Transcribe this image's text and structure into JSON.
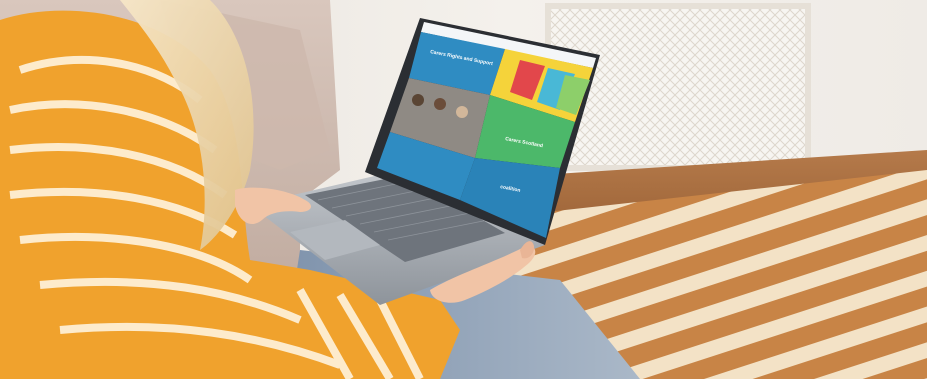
{
  "scene": {
    "site": {
      "hero_heading": "Carers Rights and Support",
      "feature_heading": "Carers Scotland",
      "footer_logo_text": "coalition"
    },
    "colors": {
      "wall": "#f2efeb",
      "floor": "#8a4c22",
      "rug_stripe": "#f3e2c6",
      "sweater": "#f0a22d",
      "sweater_stripe": "#fff3de",
      "laptop": "#a8adb4",
      "site_blue": "#2f8cc2",
      "site_green": "#4cb86a"
    }
  }
}
